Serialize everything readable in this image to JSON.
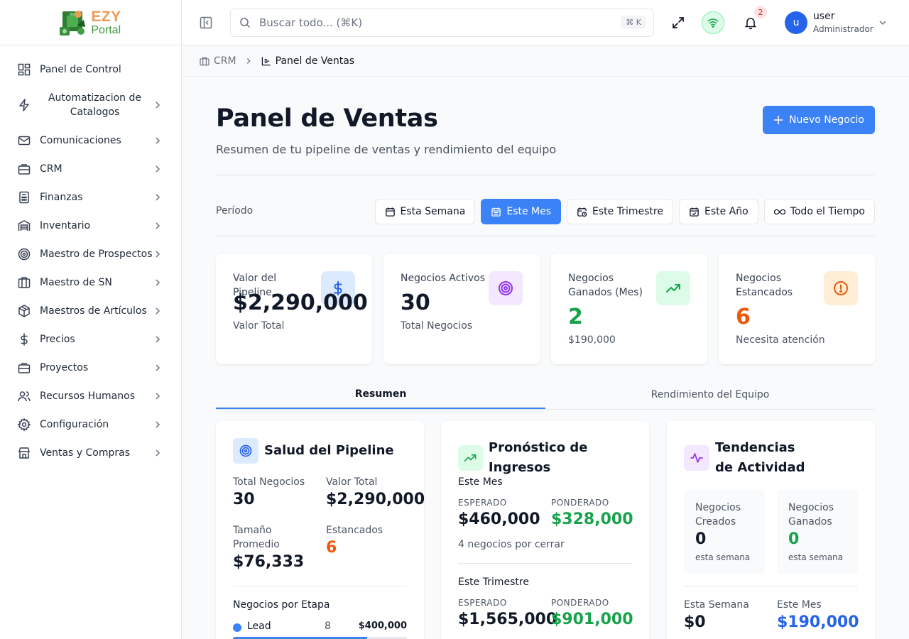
{
  "brand": {
    "line1": "EZY",
    "line2": "Portal"
  },
  "sidebar": {
    "items": [
      {
        "label": "Panel de Control"
      },
      {
        "label": "Automatizacion de Catalogos"
      },
      {
        "label": "Comunicaciones"
      },
      {
        "label": "CRM"
      },
      {
        "label": "Finanzas"
      },
      {
        "label": "Inventario"
      },
      {
        "label": "Maestro de Prospectos"
      },
      {
        "label": "Maestro de SN"
      },
      {
        "label": "Maestros de Artículos"
      },
      {
        "label": "Precios"
      },
      {
        "label": "Proyectos"
      },
      {
        "label": "Recursos Humanos"
      },
      {
        "label": "Configuración"
      },
      {
        "label": "Ventas y Compras"
      }
    ]
  },
  "topbar": {
    "search_placeholder": "Buscar todo... (⌘K)",
    "shortcut": "⌘ K",
    "notifications_count": "2",
    "user": {
      "initial": "u",
      "name": "user",
      "role": "Administrador"
    }
  },
  "breadcrumb": {
    "parent": "CRM",
    "current": "Panel de Ventas"
  },
  "page": {
    "title": "Panel de Ventas",
    "subtitle": "Resumen de tu pipeline de ventas y rendimiento del equipo",
    "new_button": "Nuevo Negocio"
  },
  "period": {
    "label": "Período",
    "options": [
      "Esta Semana",
      "Este Mes",
      "Este Trimestre",
      "Este Año",
      "Todo el Tiempo"
    ],
    "selected": "Este Mes"
  },
  "kpis": [
    {
      "title": "Valor del Pipeline",
      "value": "$2,290,000",
      "sub": "Valor Total"
    },
    {
      "title": "Negocios Activos",
      "value": "30",
      "sub": "Total Negocios"
    },
    {
      "title": "Negocios Ganados (Mes)",
      "value": "2",
      "sub": "$190,000"
    },
    {
      "title": "Negocios Estancados",
      "value": "6",
      "sub": "Necesita atención"
    }
  ],
  "tabs": [
    {
      "label": "Resumen"
    },
    {
      "label": "Rendimiento del Equipo"
    }
  ],
  "pipeline_health": {
    "title": "Salud del Pipeline",
    "total_deals_label": "Total Negocios",
    "total_deals": "30",
    "total_value_label": "Valor Total",
    "total_value": "$2,290,000",
    "avg_size_label": "Tamaño Promedio",
    "avg_size": "$76,333",
    "stalled_label": "Estancados",
    "stalled": "6",
    "by_stage_label": "Negocios por Etapa",
    "stages": [
      {
        "name": "Lead",
        "count": "8",
        "value": "$400,000",
        "fill": 0.77
      }
    ]
  },
  "forecast": {
    "title": "Pronóstico de Ingresos",
    "month": {
      "label": "Este Mes",
      "expected_label": "ESPERADO",
      "expected": "$460,000",
      "weighted_label": "PONDERADO",
      "weighted": "$328,000",
      "note": "4 negocios por cerrar"
    },
    "quarter": {
      "label": "Este Trimestre",
      "expected_label": "ESPERADO",
      "expected": "$1,565,000",
      "weighted_label": "PONDERADO",
      "weighted": "$901,000"
    }
  },
  "activity": {
    "title": "Tendencias de Actividad",
    "created": {
      "label": "Negocios Creados",
      "value": "0",
      "note": "esta semana"
    },
    "won": {
      "label": "Negocios Ganados",
      "value": "0",
      "note": "esta semana"
    },
    "week_label": "Esta Semana",
    "week_value": "$0",
    "month_label": "Este Mes",
    "month_value": "$190,000"
  },
  "colors": {
    "primary": "#3b82f6",
    "success": "#16a34a",
    "warning": "#ea580c",
    "brand_orange": "#ef9a55",
    "brand_green": "#3f9b3a"
  },
  "icons": {
    "kpi": [
      "dollar-icon",
      "target-icon",
      "trending-up-icon",
      "alert-circle-icon"
    ]
  }
}
